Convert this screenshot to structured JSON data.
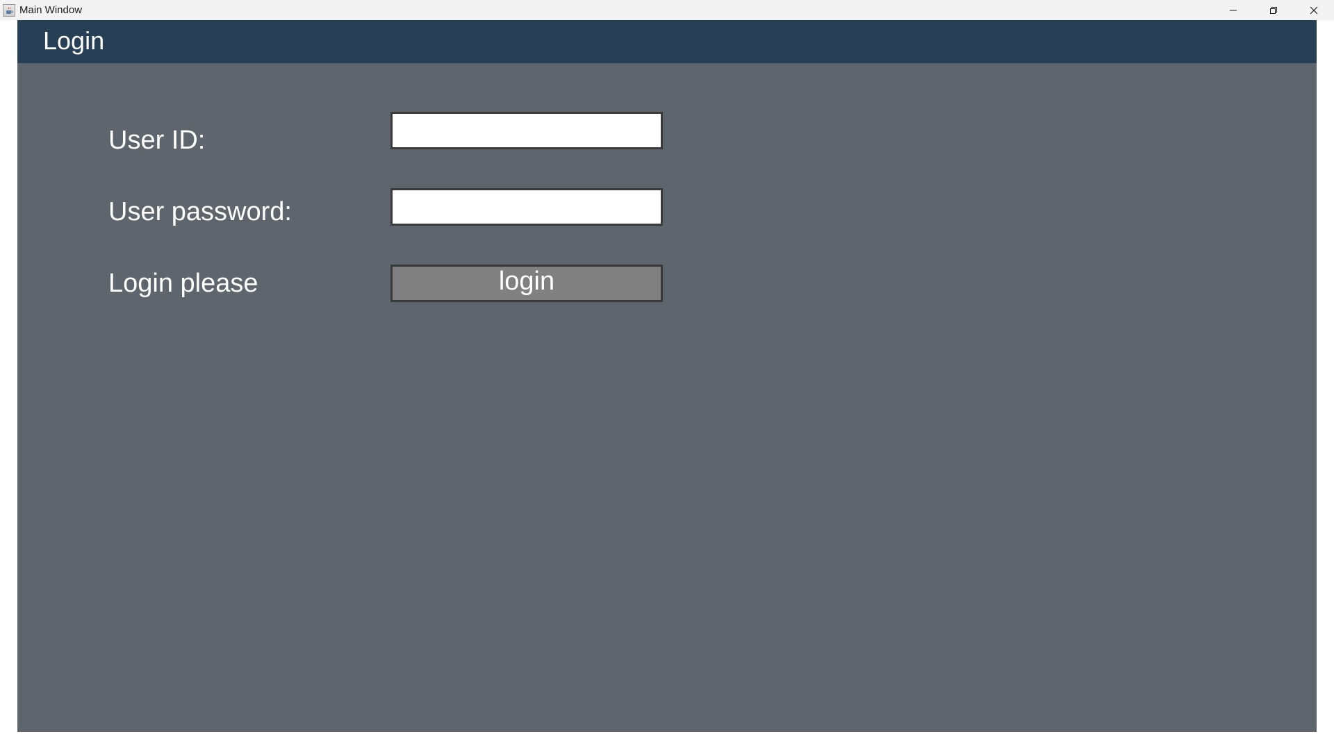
{
  "window": {
    "title": "Main Window",
    "app_icon": "java-cup-icon"
  },
  "header": {
    "title": "Login",
    "background": "#263f55"
  },
  "form": {
    "user_id_label": "User ID:",
    "user_id_value": "",
    "user_password_label": "User password:",
    "user_password_value": "",
    "status_text": "Login please",
    "login_button_label": "login"
  },
  "colors": {
    "panel_background": "#5e656d",
    "button_background": "#808080",
    "text": "#ffffff"
  }
}
